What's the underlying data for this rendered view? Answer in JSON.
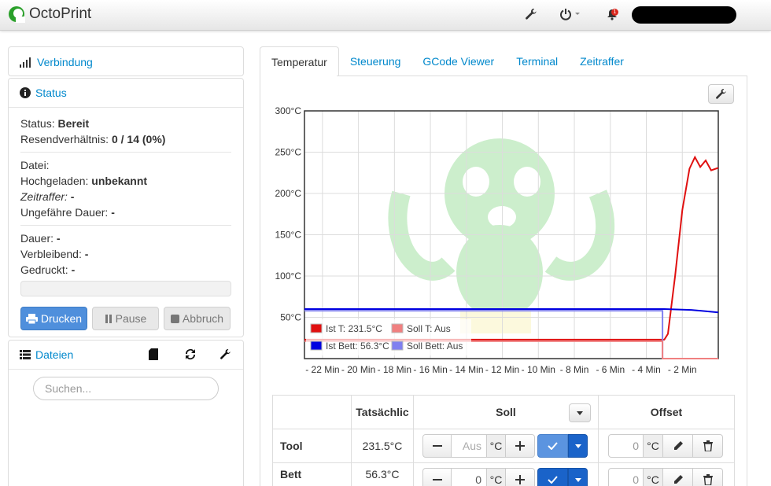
{
  "navbar": {
    "brand": "OctoPrint",
    "notification_count": "1"
  },
  "sidebar": {
    "connection_title": "Verbindung",
    "status_title": "Status",
    "status_label": "Status:",
    "status_value": "Bereit",
    "resend_label": "Resendverhältnis:",
    "resend_value": "0 / 14 (0%)",
    "file_label": "Datei:",
    "uploaded_label": "Hochgeladen:",
    "uploaded_value": "unbekannt",
    "timelapse_label": "Zeitraffer:",
    "timelapse_value": "-",
    "approx_label": "Ungefähre Dauer:",
    "approx_value": "-",
    "duration_label": "Dauer:",
    "duration_value": "-",
    "remaining_label": "Verbleibend:",
    "remaining_value": "-",
    "printed_label": "Gedruckt:",
    "printed_value": "-",
    "print_button": "Drucken",
    "pause_button": "Pause",
    "cancel_button": "Abbruch",
    "files_title": "Dateien",
    "search_placeholder": "Suchen..."
  },
  "tabs": [
    "Temperatur",
    "Steuerung",
    "GCode Viewer",
    "Terminal",
    "Zeitraffer"
  ],
  "chart_data": {
    "type": "line",
    "y_ticks": [
      "300°C",
      "250°C",
      "200°C",
      "150°C",
      "100°C",
      "50°C"
    ],
    "x_ticks": [
      "- 22 Min",
      "- 20 Min",
      "- 18 Min",
      "- 16 Min",
      "- 14 Min",
      "- 12 Min",
      "- 10 Min",
      "- 8 Min",
      "- 6 Min",
      "- 4 Min",
      "- 2 Min"
    ],
    "ylim": [
      0,
      300
    ],
    "xlim": [
      -23,
      0
    ],
    "legend_placement": "bottom-left",
    "legend": [
      {
        "label": "Ist T: 231.5°C",
        "color": "#e01010"
      },
      {
        "label": "Soll T: Aus",
        "color": "#f08080"
      },
      {
        "label": "Ist Bett: 56.3°C",
        "color": "#0000e0"
      },
      {
        "label": "Soll Bett: Aus",
        "color": "#8080f0"
      }
    ],
    "series": [
      {
        "name": "Ist T: 231.5°C",
        "color": "#e01010",
        "x": [
          -23,
          -3,
          -2.8,
          -2.4,
          -2.0,
          -1.6,
          -1.3,
          -1.0,
          -0.7,
          -0.4,
          0
        ],
        "y": [
          23,
          23,
          30,
          100,
          180,
          230,
          244,
          232,
          240,
          228,
          231
        ]
      },
      {
        "name": "Ist Bett: 56.3°C",
        "color": "#0000e0",
        "x": [
          -23,
          -3,
          -1.5,
          0
        ],
        "y": [
          60,
          60,
          59,
          56
        ]
      },
      {
        "name": "Soll Bett: Aus",
        "color": "#8080f0",
        "x": [
          -23,
          -3.1,
          -3.1,
          0
        ],
        "y": [
          58,
          58,
          0,
          0
        ]
      },
      {
        "name": "Soll T: Aus",
        "color": "#f08080",
        "x": [
          -23,
          -3.1,
          -3.1,
          0
        ],
        "y": [
          21,
          21,
          0,
          0
        ]
      }
    ]
  },
  "temp_table": {
    "headers": [
      "",
      "Tatsächlic",
      "Soll",
      "Offset"
    ],
    "rows": [
      {
        "name": "Tool",
        "actual": "231.5°C",
        "target_placeholder": "Aus",
        "unit": "°C",
        "offset": "0"
      },
      {
        "name": "Bett",
        "actual": "56.3°C",
        "target_value": "0",
        "unit": "°C",
        "offset": "0"
      }
    ]
  },
  "icons": [
    "wrench-icon",
    "power-icon",
    "bell-icon",
    "signal-icon",
    "info-icon",
    "list-icon",
    "sd-card-icon",
    "refresh-icon",
    "print-icon",
    "pause-icon",
    "stop-icon",
    "minus-icon",
    "plus-icon",
    "check-icon",
    "caret-down-icon",
    "pencil-icon",
    "trash-icon"
  ],
  "colors": {
    "link": "#0088cc",
    "primary": "#4f8fdc",
    "dropdown_primary": "#1a63c9"
  }
}
